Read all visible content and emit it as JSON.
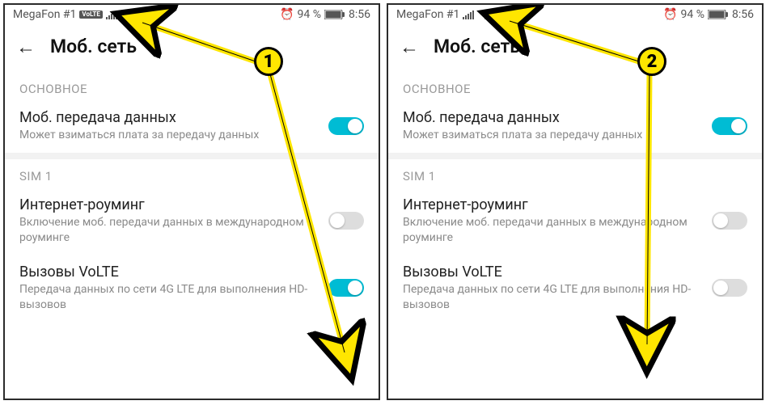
{
  "panels": [
    {
      "marker": "1",
      "status": {
        "carrier": "MegaFon #1",
        "volte_badge": "VoLTE",
        "battery_pct": "94 %",
        "time": "8:56"
      },
      "header": {
        "title": "Моб. сеть"
      },
      "section_main": "ОСНОВНОЕ",
      "mobile_data": {
        "title": "Моб. передача данных",
        "desc": "Может взиматься плата за передачу данных",
        "on": true
      },
      "section_sim": "SIM 1",
      "roaming": {
        "title": "Интернет-роуминг",
        "desc": "Включение моб. передачи данных в международном роуминге",
        "on": false
      },
      "volte": {
        "title": "Вызовы VoLTE",
        "desc": "Передача данных по сети 4G LTE для выполнения HD-вызовов",
        "on": true
      }
    },
    {
      "marker": "2",
      "status": {
        "carrier": "MegaFon #1",
        "volte_badge": "",
        "battery_pct": "94 %",
        "time": "8:56"
      },
      "header": {
        "title": "Моб. сеть"
      },
      "section_main": "ОСНОВНОЕ",
      "mobile_data": {
        "title": "Моб. передача данных",
        "desc": "Может взиматься плата за передачу данных",
        "on": true
      },
      "section_sim": "SIM 1",
      "roaming": {
        "title": "Интернет-роуминг",
        "desc": "Включение моб. передачи данных в международном роуминге",
        "on": false
      },
      "volte": {
        "title": "Вызовы VoLTE",
        "desc": "Передача данных по сети 4G LTE для выполнения HD-вызовов",
        "on": false
      }
    }
  ],
  "icons": {
    "alarm": "⏰"
  }
}
